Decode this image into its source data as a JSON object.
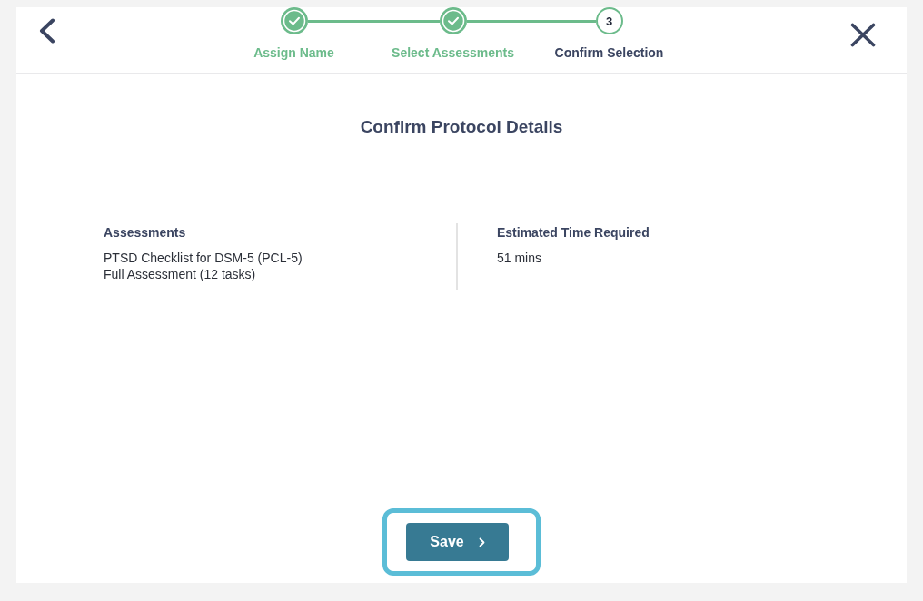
{
  "stepper": {
    "steps": [
      {
        "label": "Assign Name",
        "completed": true
      },
      {
        "label": "Select Assessments",
        "completed": true
      },
      {
        "label": "Confirm Selection",
        "number": "3",
        "completed": false
      }
    ]
  },
  "page_title": "Confirm Protocol Details",
  "details": [
    {
      "heading": "Assessments",
      "lines": [
        "PTSD Checklist for DSM-5 (PCL-5)",
        "Full Assessment (12 tasks)"
      ]
    },
    {
      "heading": "Estimated Time Required",
      "lines": [
        "51 mins"
      ]
    }
  ],
  "save_button": {
    "label": "Save",
    "highlighted": true
  }
}
